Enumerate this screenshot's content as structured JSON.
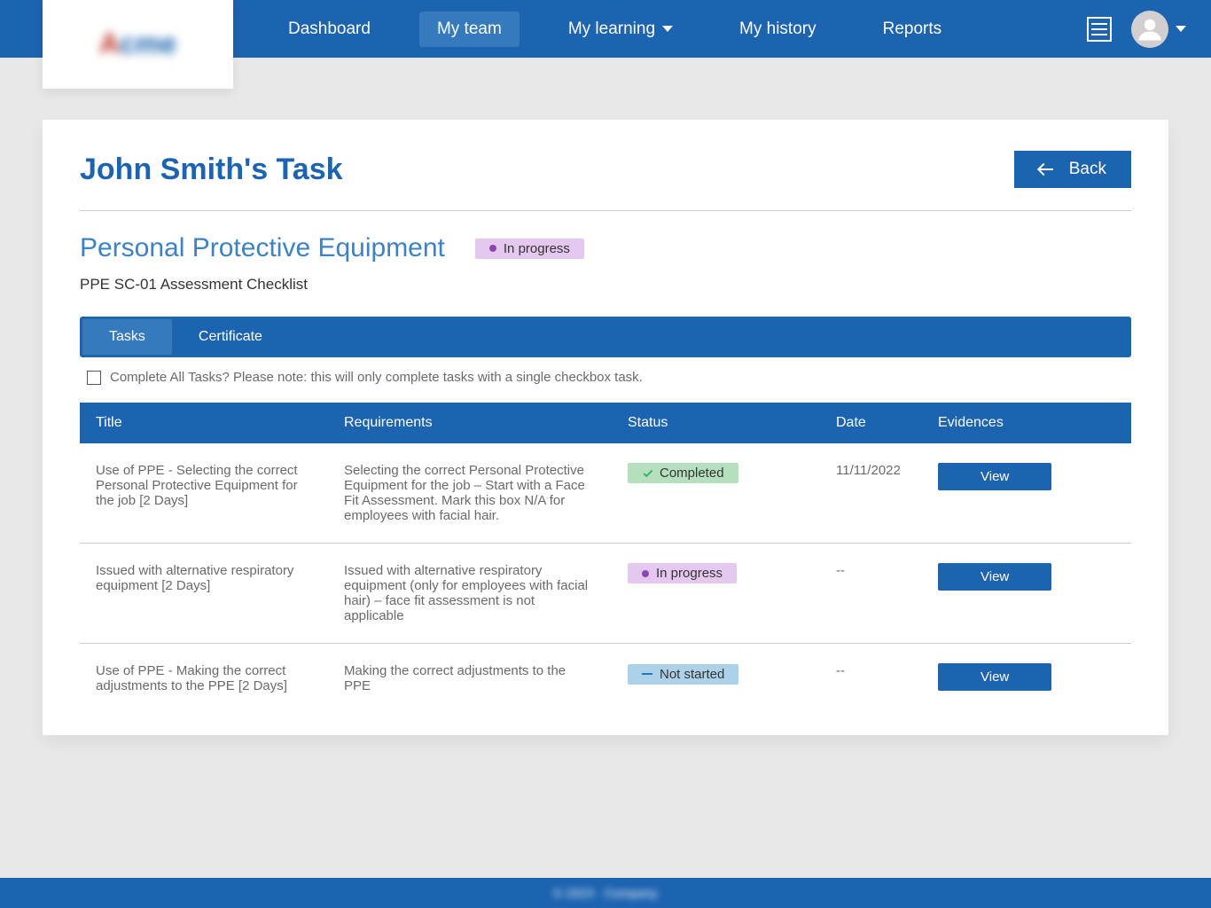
{
  "nav": {
    "items": [
      {
        "label": "Dashboard",
        "active": false,
        "dropdown": false
      },
      {
        "label": "My team",
        "active": true,
        "dropdown": false
      },
      {
        "label": "My learning",
        "active": false,
        "dropdown": true
      },
      {
        "label": "My history",
        "active": false,
        "dropdown": false
      },
      {
        "label": "Reports",
        "active": false,
        "dropdown": false
      }
    ]
  },
  "page": {
    "title": "John Smith's Task",
    "back": "Back"
  },
  "section": {
    "title": "Personal Protective Equipment",
    "status": "In progress",
    "checklist": "PPE SC-01 Assessment Checklist"
  },
  "tabs": [
    {
      "label": "Tasks",
      "active": true
    },
    {
      "label": "Certificate",
      "active": false
    }
  ],
  "completeAll": "Complete All Tasks? Please note: this will only complete tasks with a single checkbox task.",
  "columns": [
    "Title",
    "Requirements",
    "Status",
    "Date",
    "Evidences"
  ],
  "rows": [
    {
      "title": "Use of PPE - Selecting the correct Personal Protective Equipment for the job [2 Days]",
      "requirements": "Selecting the correct Personal Protective Equipment for the job – Start with a Face Fit Assessment. Mark this box N/A for employees with facial hair.",
      "status": "Completed",
      "statusType": "completed",
      "date": "11/11/2022",
      "action": "View"
    },
    {
      "title": "Issued with alternative respiratory equipment [2 Days]",
      "requirements": "Issued with alternative respiratory equipment (only for employees with facial hair) – face fit assessment is not applicable",
      "status": "In progress",
      "statusType": "progress",
      "date": "--",
      "action": "View"
    },
    {
      "title": "Use of PPE - Making the correct adjustments to the PPE [2 Days]",
      "requirements": "Making the correct adjustments to the PPE",
      "status": "Not started",
      "statusType": "notstarted",
      "date": "--",
      "action": "View"
    }
  ],
  "footer": "© 2023 · Company"
}
